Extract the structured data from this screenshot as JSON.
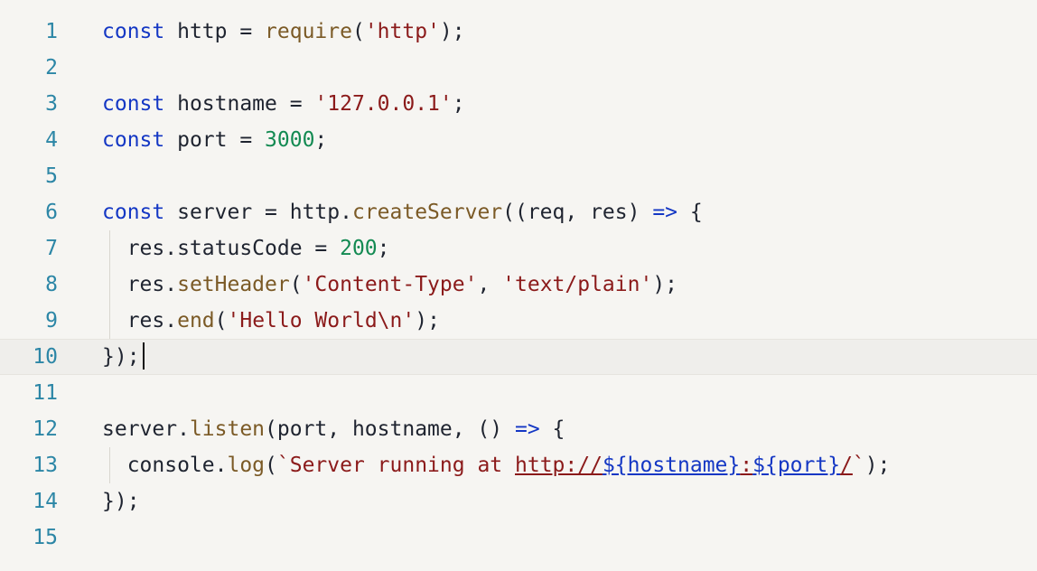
{
  "editor": {
    "lines": [
      {
        "n": "1",
        "tokens": [
          {
            "t": "const",
            "c": "kw"
          },
          {
            "t": " http = ",
            "c": "punct"
          },
          {
            "t": "require",
            "c": "fn"
          },
          {
            "t": "(",
            "c": "punct"
          },
          {
            "t": "'http'",
            "c": "str"
          },
          {
            "t": ");",
            "c": "punct"
          }
        ]
      },
      {
        "n": "2",
        "tokens": []
      },
      {
        "n": "3",
        "tokens": [
          {
            "t": "const",
            "c": "kw"
          },
          {
            "t": " hostname = ",
            "c": "punct"
          },
          {
            "t": "'127.0.0.1'",
            "c": "str"
          },
          {
            "t": ";",
            "c": "punct"
          }
        ]
      },
      {
        "n": "4",
        "tokens": [
          {
            "t": "const",
            "c": "kw"
          },
          {
            "t": " port = ",
            "c": "punct"
          },
          {
            "t": "3000",
            "c": "num"
          },
          {
            "t": ";",
            "c": "punct"
          }
        ]
      },
      {
        "n": "5",
        "tokens": []
      },
      {
        "n": "6",
        "tokens": [
          {
            "t": "const",
            "c": "kw"
          },
          {
            "t": " server = http.",
            "c": "punct"
          },
          {
            "t": "createServer",
            "c": "fn"
          },
          {
            "t": "((req, res) ",
            "c": "punct"
          },
          {
            "t": "=>",
            "c": "kw"
          },
          {
            "t": " {",
            "c": "punct"
          }
        ]
      },
      {
        "n": "7",
        "tokens": [
          {
            "t": "  res.statusCode = ",
            "c": "punct"
          },
          {
            "t": "200",
            "c": "num"
          },
          {
            "t": ";",
            "c": "punct"
          }
        ]
      },
      {
        "n": "8",
        "tokens": [
          {
            "t": "  res.",
            "c": "punct"
          },
          {
            "t": "setHeader",
            "c": "fn"
          },
          {
            "t": "(",
            "c": "punct"
          },
          {
            "t": "'Content-Type'",
            "c": "str"
          },
          {
            "t": ", ",
            "c": "punct"
          },
          {
            "t": "'text/plain'",
            "c": "str"
          },
          {
            "t": ");",
            "c": "punct"
          }
        ]
      },
      {
        "n": "9",
        "tokens": [
          {
            "t": "  res.",
            "c": "punct"
          },
          {
            "t": "end",
            "c": "fn"
          },
          {
            "t": "(",
            "c": "punct"
          },
          {
            "t": "'Hello World\\n'",
            "c": "str"
          },
          {
            "t": ");",
            "c": "punct"
          }
        ]
      },
      {
        "n": "10",
        "tokens": [
          {
            "t": "});",
            "c": "punct"
          }
        ],
        "active": true
      },
      {
        "n": "11",
        "tokens": []
      },
      {
        "n": "12",
        "tokens": [
          {
            "t": "server.",
            "c": "punct"
          },
          {
            "t": "listen",
            "c": "fn"
          },
          {
            "t": "(port, hostname, () ",
            "c": "punct"
          },
          {
            "t": "=>",
            "c": "kw"
          },
          {
            "t": " {",
            "c": "punct"
          }
        ]
      },
      {
        "n": "13",
        "tokens": [
          {
            "t": "  console.",
            "c": "punct"
          },
          {
            "t": "log",
            "c": "fn"
          },
          {
            "t": "(",
            "c": "punct"
          },
          {
            "t": "`Server running at ",
            "c": "str"
          },
          {
            "t": "http://",
            "c": "url"
          },
          {
            "t": "${hostname}",
            "c": "tmpl"
          },
          {
            "t": ":",
            "c": "url"
          },
          {
            "t": "${port}",
            "c": "tmpl"
          },
          {
            "t": "/",
            "c": "url"
          },
          {
            "t": "`",
            "c": "str"
          },
          {
            "t": ");",
            "c": "punct"
          }
        ]
      },
      {
        "n": "14",
        "tokens": [
          {
            "t": "});",
            "c": "punct"
          }
        ]
      },
      {
        "n": "15",
        "tokens": []
      }
    ]
  },
  "colors": {
    "background": "#f6f5f2",
    "line_number": "#2c86a6",
    "keyword": "#1437c4",
    "function": "#7b5a26",
    "string": "#8b1a1a",
    "number": "#138a52"
  }
}
